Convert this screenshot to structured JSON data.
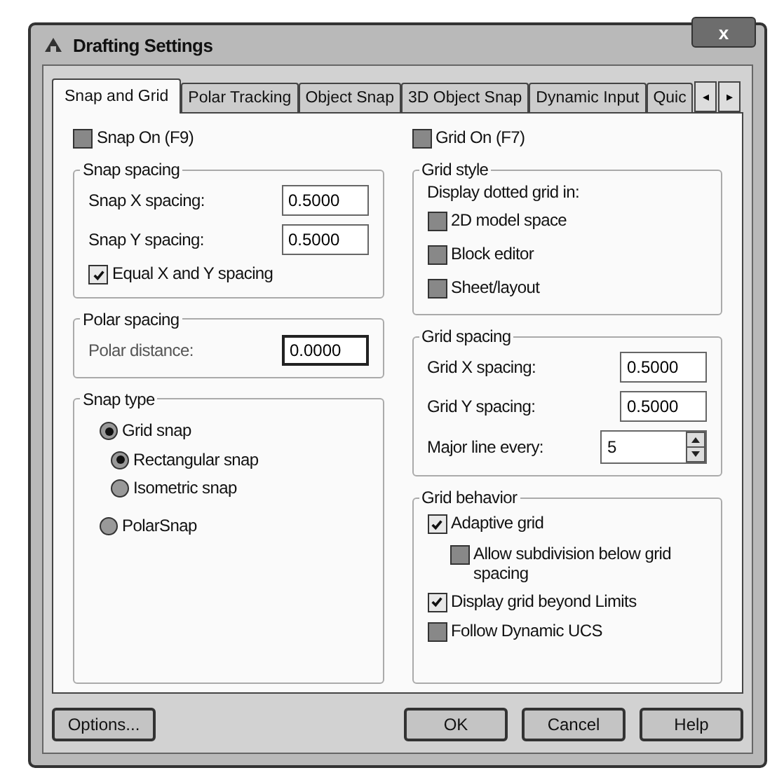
{
  "window": {
    "title": "Drafting Settings",
    "close": "x"
  },
  "tabs": [
    {
      "label": "Snap and Grid",
      "selected": true
    },
    {
      "label": "Polar Tracking",
      "selected": false
    },
    {
      "label": "Object Snap",
      "selected": false
    },
    {
      "label": "3D Object Snap",
      "selected": false
    },
    {
      "label": "Dynamic Input",
      "selected": false
    },
    {
      "label": "Quic",
      "selected": false
    }
  ],
  "tab_scroll": [
    "◂",
    "▸"
  ],
  "snap_on": {
    "label": "Snap On (F9)",
    "checked": false
  },
  "snap_spacing": {
    "title": "Snap spacing",
    "fields": [
      {
        "label": "Snap X spacing:",
        "value": "0.5000"
      },
      {
        "label": "Snap Y spacing:",
        "value": "0.5000"
      }
    ],
    "equal": {
      "label": "Equal X and Y spacing",
      "checked": true
    }
  },
  "polar_spacing": {
    "title": "Polar spacing",
    "label": "Polar distance:",
    "value": "0.0000"
  },
  "snap_type": {
    "title": "Snap type",
    "options": [
      {
        "label": "Grid snap",
        "selected": true,
        "children": [
          {
            "label": "Rectangular snap",
            "selected": true
          },
          {
            "label": "Isometric snap",
            "selected": false
          }
        ]
      },
      {
        "label": "PolarSnap",
        "selected": false
      }
    ]
  },
  "grid_on": {
    "label": "Grid On (F7)",
    "checked": false
  },
  "grid_style": {
    "title": "Grid style",
    "caption": "Display dotted grid in:",
    "options": [
      {
        "label": "2D model space",
        "checked": false
      },
      {
        "label": "Block editor",
        "checked": false
      },
      {
        "label": "Sheet/layout",
        "checked": false
      }
    ]
  },
  "grid_spacing": {
    "title": "Grid spacing",
    "fields": [
      {
        "label": "Grid X spacing:",
        "value": "0.5000"
      },
      {
        "label": "Grid Y spacing:",
        "value": "0.5000"
      }
    ],
    "major": {
      "label": "Major line every:",
      "value": "5"
    }
  },
  "grid_behavior": {
    "title": "Grid behavior",
    "options": [
      {
        "label": "Adaptive grid",
        "checked": true,
        "children": [
          {
            "label": "Allow subdivision below grid spacing",
            "checked": false
          }
        ]
      },
      {
        "label": "Display grid beyond Limits",
        "checked": true
      },
      {
        "label": "Follow Dynamic UCS",
        "checked": false
      }
    ]
  },
  "buttons": [
    {
      "label": "Options...",
      "kind": "left"
    },
    {
      "label": "OK",
      "kind": "right"
    },
    {
      "label": "Cancel",
      "kind": "right"
    },
    {
      "label": "Help",
      "kind": "right"
    }
  ]
}
